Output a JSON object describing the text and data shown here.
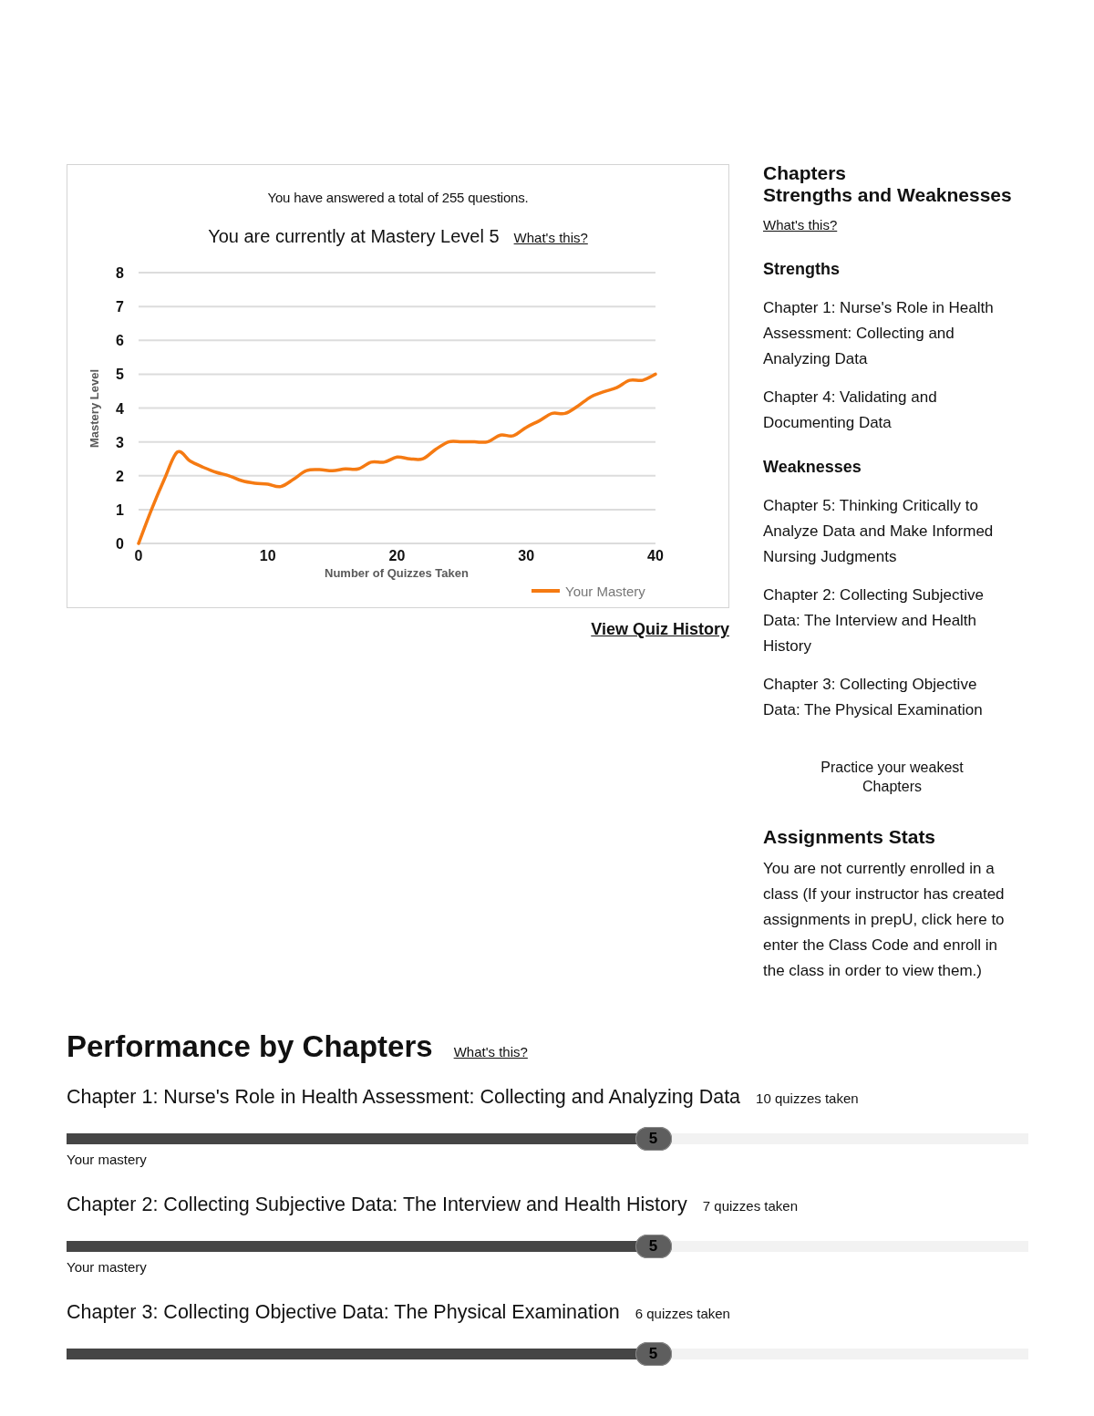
{
  "summary": {
    "total_text": "You have answered a total of 255 questions.",
    "level_text": "You are currently at Mastery Level 5",
    "help_link": "What's this?"
  },
  "chart": {
    "chart_data": {
      "type": "line",
      "xlabel": "Number of Quizzes Taken",
      "ylabel": "Mastery Level",
      "x": [
        0,
        1,
        2,
        3,
        4,
        5,
        6,
        7,
        8,
        9,
        10,
        11,
        12,
        13,
        14,
        15,
        16,
        17,
        18,
        19,
        20,
        21,
        22,
        23,
        24,
        25,
        26,
        27,
        28,
        29,
        30,
        31,
        32,
        33,
        34,
        35,
        36,
        37,
        38,
        39,
        40
      ],
      "series": [
        {
          "name": "Your Mastery",
          "color": "#f57a12",
          "values": [
            0,
            1.0,
            1.9,
            2.7,
            2.43,
            2.25,
            2.1,
            2.0,
            1.85,
            1.78,
            1.75,
            1.68,
            1.9,
            2.15,
            2.18,
            2.15,
            2.2,
            2.2,
            2.4,
            2.4,
            2.55,
            2.5,
            2.5,
            2.78,
            3.0,
            3.0,
            3.0,
            3.0,
            3.2,
            3.18,
            3.43,
            3.62,
            3.84,
            3.84,
            4.06,
            4.33,
            4.48,
            4.6,
            4.82,
            4.82,
            5.0
          ]
        }
      ],
      "xlim": [
        0,
        40
      ],
      "ylim": [
        0,
        8
      ],
      "xticks": [
        0,
        10,
        20,
        30,
        40
      ],
      "yticks": [
        0,
        1,
        2,
        3,
        4,
        5,
        6,
        7,
        8
      ],
      "grid": true
    }
  },
  "history_link": "View Quiz History",
  "strengths_panel": {
    "title": "Chapters",
    "subtitle": "Strengths and Weaknesses",
    "help_link": "What's this?",
    "groups": [
      {
        "heading": "Strengths",
        "items": [
          "Chapter 1: Nurse's Role in Health Assessment: Collecting and Analyzing Data",
          "Chapter 4: Validating and Documenting Data"
        ]
      },
      {
        "heading": "Weaknesses",
        "items": [
          "Chapter 5: Thinking Critically to Analyze Data and Make Informed Nursing Judgments",
          "Chapter 2: Collecting Subjective Data: The Interview and Health History",
          "Chapter 3: Collecting Objective Data: The Physical Examination"
        ]
      }
    ],
    "practice_button": "Practice your weakest Chapters"
  },
  "assignments": {
    "title": "Assignments Stats",
    "text": "You are not currently enrolled in a class (If your instructor has created assignments in prepU, click here to enter the Class Code and enroll in the class in order to view them.)"
  },
  "performance": {
    "title": "Performance by Chapters",
    "help_link": "What's this?",
    "chapters": [
      {
        "title": "Chapter 1: Nurse's Role in Health Assessment: Collecting and Analyzing Data",
        "quizzes": "10 quizzes taken",
        "level": 0.61,
        "badge": "5",
        "mastery_label": "Your mastery"
      },
      {
        "title": "Chapter 2: Collecting Subjective Data: The Interview and Health History",
        "quizzes": "7 quizzes taken",
        "level": 0.61,
        "badge": "5",
        "mastery_label": "Your mastery"
      },
      {
        "title": "Chapter 3: Collecting Objective Data: The Physical Examination",
        "quizzes": "6 quizzes taken",
        "level": 0.61,
        "badge": "5"
      }
    ]
  }
}
